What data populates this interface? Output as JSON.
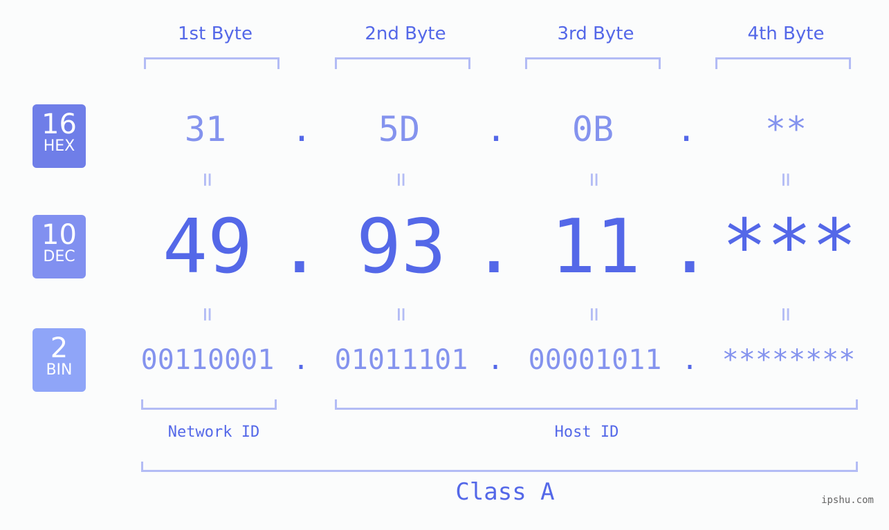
{
  "headers": [
    "1st Byte",
    "2nd Byte",
    "3rd Byte",
    "4th Byte"
  ],
  "badges": {
    "hex": {
      "num": "16",
      "label": "HEX",
      "color": "#6f7ee8"
    },
    "dec": {
      "num": "10",
      "label": "DEC",
      "color": "#8190f0"
    },
    "bin": {
      "num": "2",
      "label": "BIN",
      "color": "#8fa5f8"
    }
  },
  "hex": [
    "31",
    "5D",
    "0B",
    "**"
  ],
  "dec": [
    "49",
    "93",
    "11",
    "***"
  ],
  "bin": [
    "00110001",
    "01011101",
    "00001011",
    "********"
  ],
  "separator": ".",
  "equals": "=",
  "network_label": "Network ID",
  "host_label": "Host ID",
  "class_label": "Class A",
  "watermark": "ipshu.com"
}
